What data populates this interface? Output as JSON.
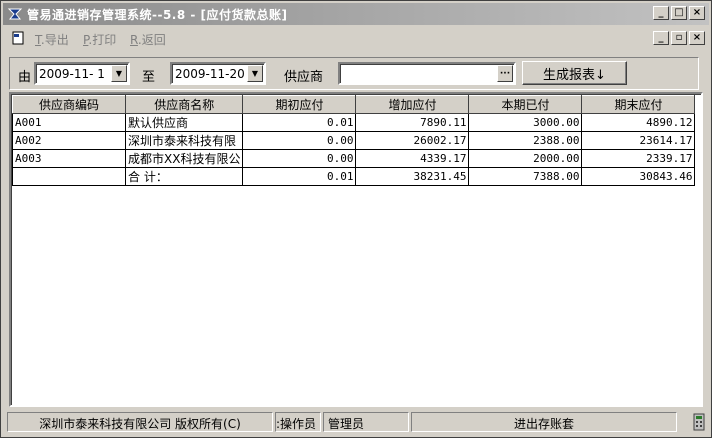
{
  "window": {
    "title": "管易通进销存管理系统--5.8 - [应付货款总账]",
    "caption_buttons": {
      "minimize": "_",
      "maximize": "□",
      "close": "×"
    },
    "mdi_buttons": {
      "minimize": "_",
      "restore": "▫",
      "close": "×"
    }
  },
  "menu": {
    "items": [
      {
        "hotkey": "T",
        "label": ".导出"
      },
      {
        "hotkey": "P",
        "label": ".打印"
      },
      {
        "hotkey": "R",
        "label": ".返回"
      }
    ]
  },
  "toolbar": {
    "from_label": "由",
    "start_date": "2009-11- 1",
    "to_label": "至",
    "end_date": "2009-11-20",
    "supplier_label": "供应商",
    "supplier_value": "",
    "browse_label": "···",
    "generate_label": "生成报表↓"
  },
  "table": {
    "headers": [
      "供应商编码",
      "供应商名称",
      "期初应付",
      "增加应付",
      "本期已付",
      "期末应付"
    ],
    "rows": [
      [
        "A001",
        "默认供应商",
        "0.01",
        "7890.11",
        "3000.00",
        "4890.12"
      ],
      [
        "A002",
        "深圳市泰来科技有限",
        "0.00",
        "26002.17",
        "2388.00",
        "23614.17"
      ],
      [
        "A003",
        "成都市XX科技有限公",
        "0.00",
        "4339.17",
        "2000.00",
        "2339.17"
      ],
      [
        "",
        "合 计：",
        "0.01",
        "38231.45",
        "7388.00",
        "30843.46"
      ]
    ]
  },
  "status": {
    "copyright": "深圳市泰来科技有限公司 版权所有(C)",
    "operator_label": "操作员:",
    "operator": "管理员",
    "account": "进出存账套"
  },
  "colors": {
    "title_gradient_start": "#8a8a8a",
    "title_gradient_end": "#c2c2c2",
    "face": "#d4d0c8"
  }
}
